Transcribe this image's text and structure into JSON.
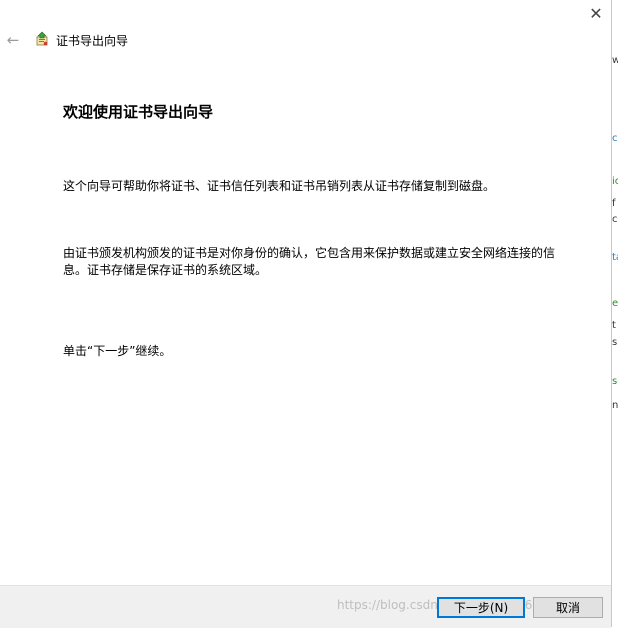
{
  "window": {
    "close_glyph": "✕",
    "back_glyph": "←",
    "title": "证书导出向导"
  },
  "main": {
    "heading": "欢迎使用证书导出向导",
    "paragraph1": "这个向导可帮助你将证书、证书信任列表和证书吊销列表从证书存储复制到磁盘。",
    "paragraph2_line1": "由证书颁发机构颁发的证书是对你身份的确认，它包含用来保护数据或建立安全网络连接的信",
    "paragraph2_line2": "息。证书存储是保存证书的系统区域。",
    "paragraph3": "单击“下一步”继续。"
  },
  "footer": {
    "next_label": "下一步(N)",
    "cancel_label": "取消",
    "watermark": "https://blog.csdn.net/qq_44019666"
  },
  "background_window": {
    "fragments": [
      "w",
      "cu",
      "ic",
      "f",
      "c",
      "ta",
      "ec",
      "t",
      "s",
      "se",
      "n"
    ]
  },
  "colors": {
    "accent": "#0078d7",
    "footer_bg": "#f0f0f0",
    "button_bg": "#e1e1e1"
  },
  "icons": {
    "app": "certificate-export-icon",
    "back": "back-arrow-icon",
    "close": "close-icon"
  }
}
